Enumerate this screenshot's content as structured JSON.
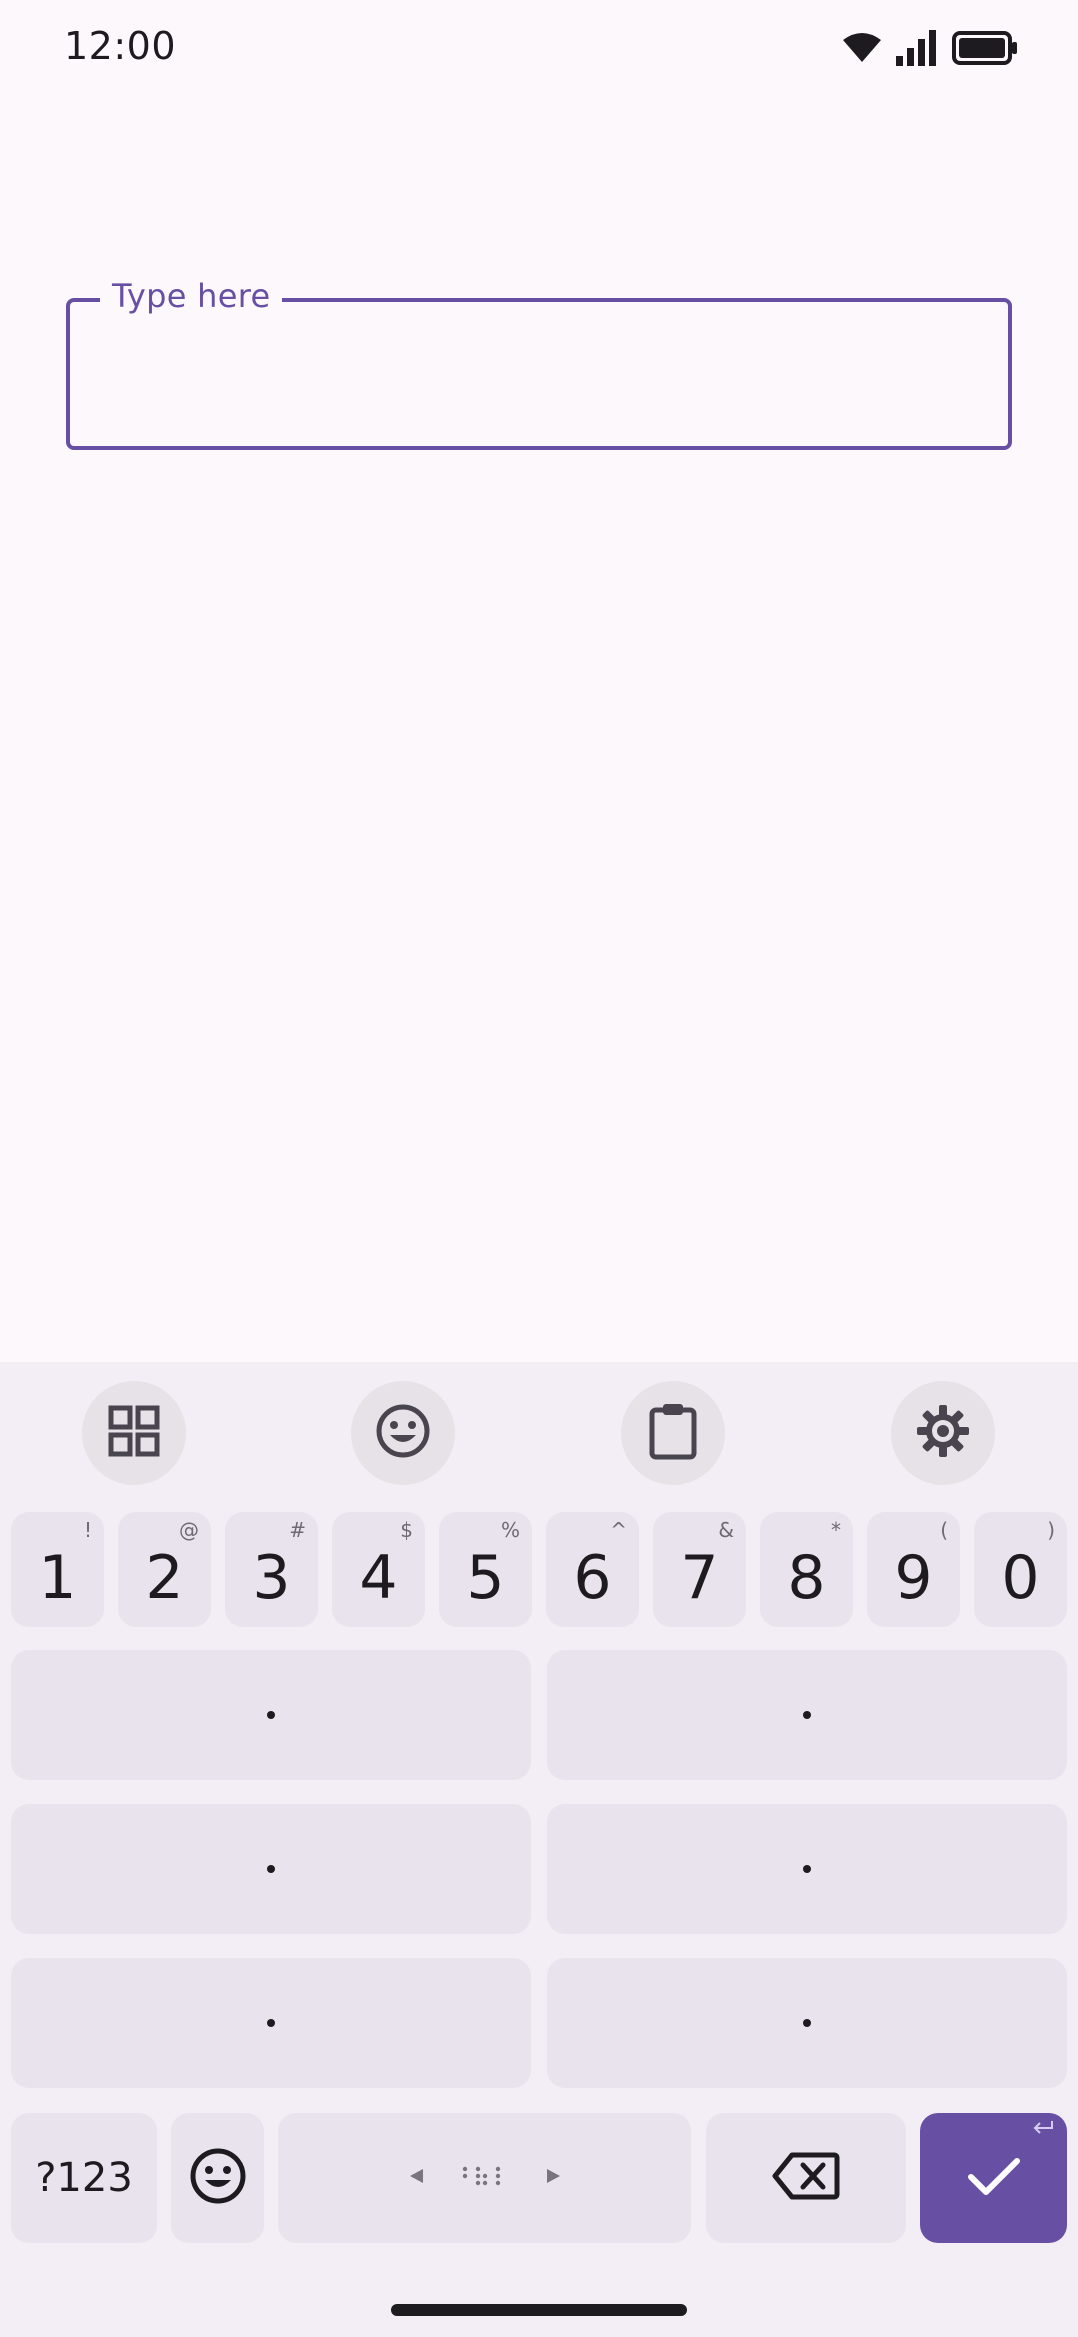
{
  "status_bar": {
    "time": "12:00",
    "icons": [
      "wifi-icon",
      "signal-icon",
      "battery-icon"
    ]
  },
  "text_field": {
    "label": "Type here",
    "value": "",
    "accent_color": "#6750A4"
  },
  "keyboard": {
    "toolbar": [
      "apps-grid-icon",
      "emoji-icon",
      "clipboard-icon",
      "settings-icon"
    ],
    "number_row": [
      {
        "main": "1",
        "sup": "!"
      },
      {
        "main": "2",
        "sup": "@"
      },
      {
        "main": "3",
        "sup": "#"
      },
      {
        "main": "4",
        "sup": "$"
      },
      {
        "main": "5",
        "sup": "%"
      },
      {
        "main": "6",
        "sup": "^"
      },
      {
        "main": "7",
        "sup": "&"
      },
      {
        "main": "8",
        "sup": "*"
      },
      {
        "main": "9",
        "sup": "("
      },
      {
        "main": "0",
        "sup": ")"
      }
    ],
    "symbols_label": "?123",
    "enter_color": "#6750A4"
  }
}
